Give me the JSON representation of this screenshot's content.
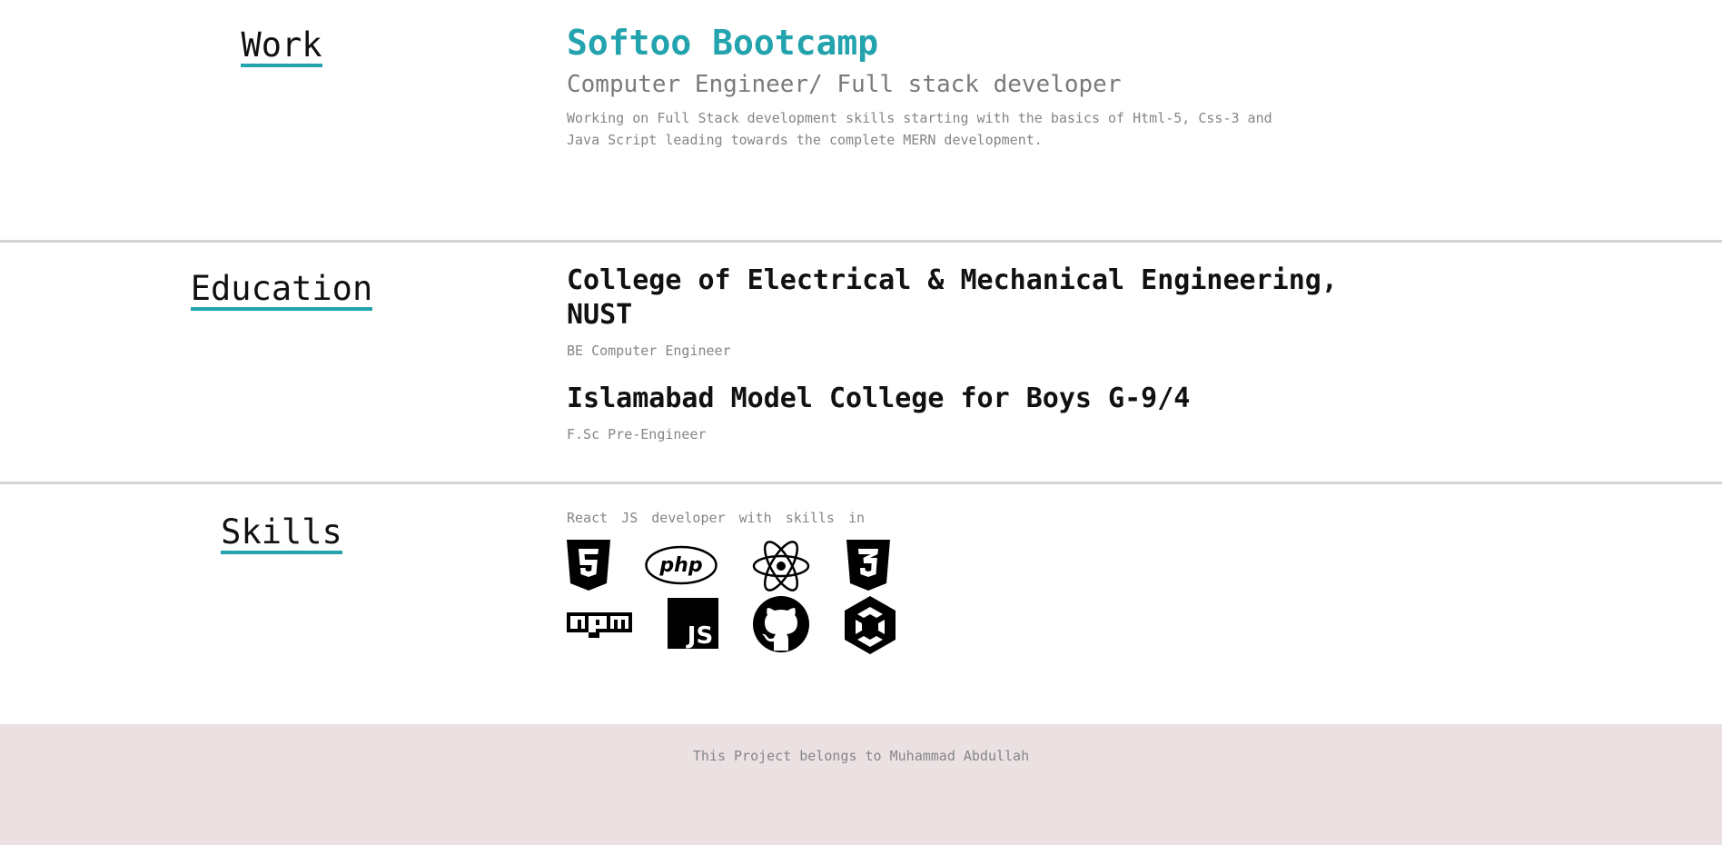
{
  "work": {
    "heading": "Work",
    "company": "Softoo Bootcamp",
    "role": "Computer Engineer/ Full stack developer",
    "description": "Working on Full Stack development skills starting with the basics of Html-5, Css-3 and Java Script leading towards the complete MERN development."
  },
  "education": {
    "heading": "Education",
    "entries": [
      {
        "school": "College of Electrical & Mechanical Engineering, NUST",
        "degree": "BE Computer Engineer"
      },
      {
        "school": "Islamabad Model College for Boys G-9/4",
        "degree": "F.Sc Pre-Engineer"
      }
    ]
  },
  "skills": {
    "heading": "Skills",
    "intro": "React JS developer with skills in",
    "icons": [
      "html5-icon",
      "php-icon",
      "react-icon",
      "css3-icon",
      "npm-icon",
      "javascript-icon",
      "github-icon",
      "unity-icon"
    ]
  },
  "footer": {
    "text": "This Project belongs to Muhammad Abdullah"
  },
  "colors": {
    "accent": "#23a3ad",
    "footer_bg": "#ebe1e2",
    "muted_text": "#858585"
  }
}
